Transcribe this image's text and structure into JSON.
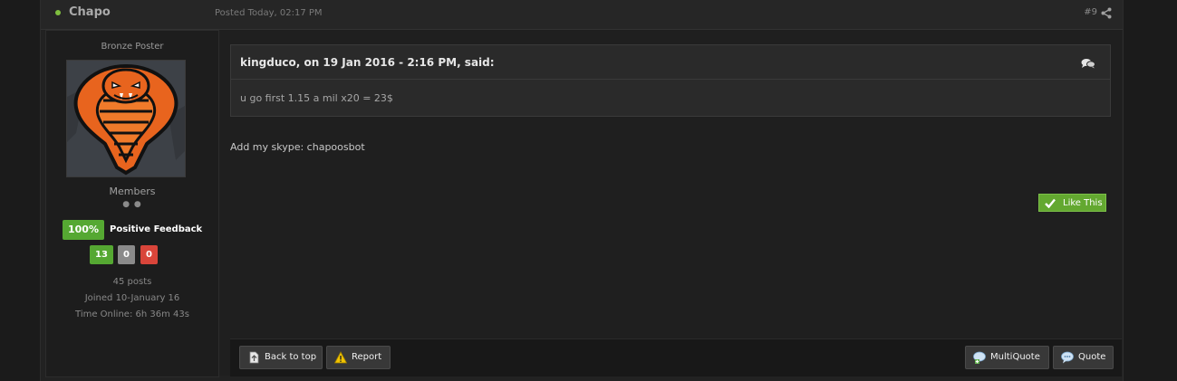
{
  "header": {
    "author": "Chapo",
    "posted": "Posted Today, 02:17 PM",
    "post_number": "#9",
    "share_icon": "share-icon",
    "online_color": "#7fbf3f"
  },
  "author_panel": {
    "rank_title": "Bronze Poster",
    "avatar": "cobra-avatar",
    "group": "Members",
    "pips": "● ●",
    "feedback_percent": "100%",
    "feedback_label": "Positive Feedback",
    "positive_count": "13",
    "neutral_count": "0",
    "negative_count": "0",
    "posts": "45 posts",
    "joined": "Joined 10-January 16",
    "time_online": "Time Online: 6h 36m 43s"
  },
  "quote": {
    "citation": "kingduco, on 19 Jan 2016 - 2:16 PM, said:",
    "icon": "speech-bubbles-icon",
    "text": "u go first 1.15 a mil x20 = 23$"
  },
  "post": {
    "text": "Add my skype: chapoosbot"
  },
  "like": {
    "label": "Like This",
    "color": "#63a830"
  },
  "footer": {
    "back_to_top": "Back to top",
    "report": "Report",
    "multiquote": "MultiQuote",
    "quote": "Quote"
  }
}
